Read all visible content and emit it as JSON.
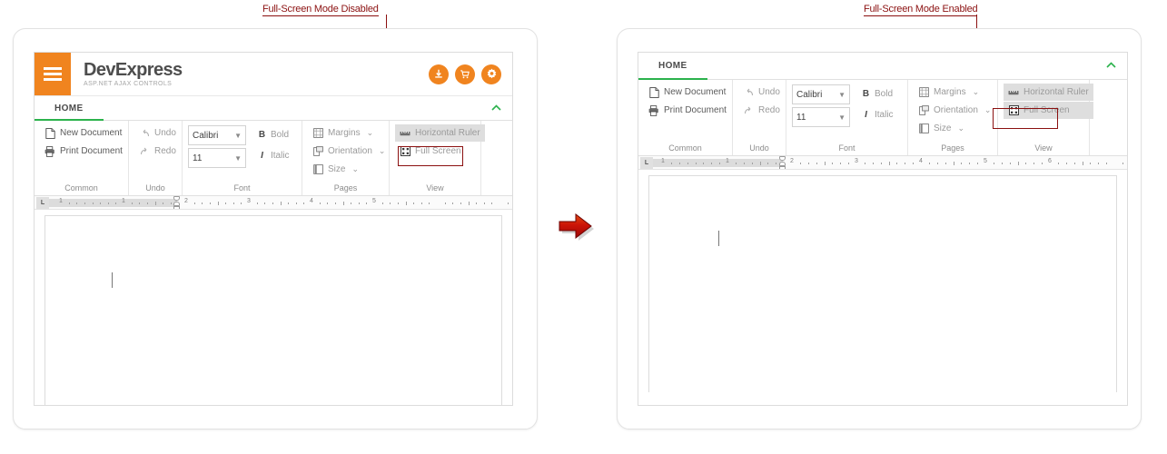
{
  "annotations": {
    "left_caption": "Full-Screen Mode Disabled",
    "right_caption": "Full-Screen Mode Enabled",
    "accent_color": "#8b1010"
  },
  "arrow": {
    "name": "red-right-arrow",
    "color": "#c81010"
  },
  "left_panel": {
    "header": {
      "menu_icon": "hamburger-icon",
      "title": "DevExpress",
      "subtitle": "ASP.NET AJAX CONTROLS",
      "brand_color": "#f0841f",
      "actions": [
        {
          "name": "download-icon",
          "label": "Download"
        },
        {
          "name": "cart-icon",
          "label": "Buy"
        },
        {
          "name": "gear-icon",
          "label": "Settings"
        }
      ]
    },
    "ribbon": {
      "tabs": [
        {
          "label": "HOME",
          "active": true
        }
      ],
      "collapse_icon": "chevron-up-icon",
      "accent_color": "#2bb24c",
      "groups": [
        {
          "label": "Common",
          "items": [
            {
              "label": "New Document",
              "icon": "new-document-icon",
              "enabled": true
            },
            {
              "label": "Print Document",
              "icon": "print-document-icon",
              "enabled": true
            }
          ]
        },
        {
          "label": "Undo",
          "items": [
            {
              "label": "Undo",
              "icon": "undo-icon",
              "enabled": false
            },
            {
              "label": "Redo",
              "icon": "redo-icon",
              "enabled": false
            }
          ]
        },
        {
          "label": "Font",
          "font_family_value": "Calibri",
          "font_size_value": "11",
          "bold_label": "Bold",
          "italic_label": "Italic"
        },
        {
          "label": "Pages",
          "items": [
            {
              "label": "Margins",
              "icon": "margins-icon",
              "dropdown": true
            },
            {
              "label": "Orientation",
              "icon": "orientation-icon",
              "dropdown": true
            },
            {
              "label": "Size",
              "icon": "page-size-icon",
              "dropdown": true
            }
          ]
        },
        {
          "label": "View",
          "items": [
            {
              "label": "Horizontal Ruler",
              "icon": "horizontal-ruler-icon",
              "toggled": true
            },
            {
              "label": "Full Screen",
              "icon": "full-screen-icon",
              "toggled": false,
              "highlighted": true
            }
          ]
        }
      ]
    },
    "ruler": {
      "tab_marker": "L",
      "numbers": [
        "1",
        "1",
        "2",
        "3",
        "4",
        "5"
      ]
    },
    "document": {
      "caret_visible": true
    }
  },
  "right_panel": {
    "ribbon": {
      "tabs": [
        {
          "label": "HOME",
          "active": true
        }
      ],
      "collapse_icon": "chevron-up-icon",
      "accent_color": "#2bb24c",
      "groups": [
        {
          "label": "Common",
          "items": [
            {
              "label": "New Document",
              "icon": "new-document-icon",
              "enabled": true
            },
            {
              "label": "Print Document",
              "icon": "print-document-icon",
              "enabled": true
            }
          ]
        },
        {
          "label": "Undo",
          "items": [
            {
              "label": "Undo",
              "icon": "undo-icon",
              "enabled": false
            },
            {
              "label": "Redo",
              "icon": "redo-icon",
              "enabled": false
            }
          ]
        },
        {
          "label": "Font",
          "font_family_value": "Calibri",
          "font_size_value": "11",
          "bold_label": "Bold",
          "italic_label": "Italic"
        },
        {
          "label": "Pages",
          "items": [
            {
              "label": "Margins",
              "icon": "margins-icon",
              "dropdown": true
            },
            {
              "label": "Orientation",
              "icon": "orientation-icon",
              "dropdown": true
            },
            {
              "label": "Size",
              "icon": "page-size-icon",
              "dropdown": true
            }
          ]
        },
        {
          "label": "View",
          "items": [
            {
              "label": "Horizontal Ruler",
              "icon": "horizontal-ruler-icon",
              "toggled": true
            },
            {
              "label": "Full Screen",
              "icon": "full-screen-icon",
              "toggled": true,
              "highlighted": true
            }
          ]
        }
      ]
    },
    "ruler": {
      "tab_marker": "L",
      "numbers": [
        "1",
        "1",
        "2",
        "3",
        "4",
        "5",
        "6"
      ]
    },
    "document": {
      "caret_visible": true
    }
  }
}
